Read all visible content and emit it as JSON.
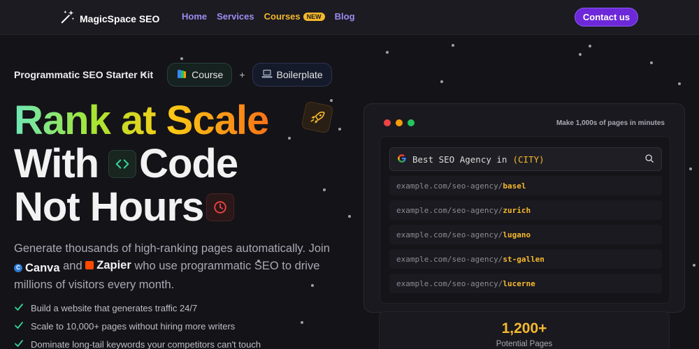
{
  "nav": {
    "brand": "MagicSpace SEO",
    "links": [
      {
        "label": "Home"
      },
      {
        "label": "Services"
      },
      {
        "label": "Courses",
        "badge": "NEW"
      },
      {
        "label": "Blog"
      }
    ],
    "contact_label": "Contact us"
  },
  "kit": {
    "title": "Programmatic SEO Starter Kit",
    "course_label": "Course",
    "plus": "+",
    "boilerplate_label": "Boilerplate"
  },
  "hero": {
    "line1": "Rank at Scale",
    "line2_a": "With",
    "line2_b": "Code",
    "line3": "Not Hours",
    "icons": [
      "rocket-icon",
      "code-icon",
      "clock-icon"
    ]
  },
  "paragraph": {
    "part1": "Generate thousands of high-ranking pages automatically. Join",
    "canva": "Canva",
    "and": "and",
    "zapier": "Zapier",
    "part2": "who use programmatic SEO to drive millions of visitors every month."
  },
  "bullets": [
    "Build a website that generates traffic 24/7",
    "Scale to 10,000+ pages without hiring more writers",
    "Dominate long-tail keywords your competitors can't touch"
  ],
  "panel": {
    "caption": "Make 1,000s of pages in minutes",
    "search_prefix": "Best SEO Agency in",
    "search_city": "(CITY)",
    "url_base": "example.com/seo-agency/",
    "slugs": [
      "basel",
      "zurich",
      "lugano",
      "st-gallen",
      "lucerne"
    ]
  },
  "stat": {
    "value": "1,200+",
    "label": "Potential Pages"
  },
  "colors": {
    "accent": "#6d28d9",
    "link": "#9d8cf0",
    "highlight": "#f5b92c",
    "check": "#34d399",
    "dot_red": "#ef4444",
    "dot_yellow": "#f59e0b",
    "dot_green": "#22c55e"
  }
}
